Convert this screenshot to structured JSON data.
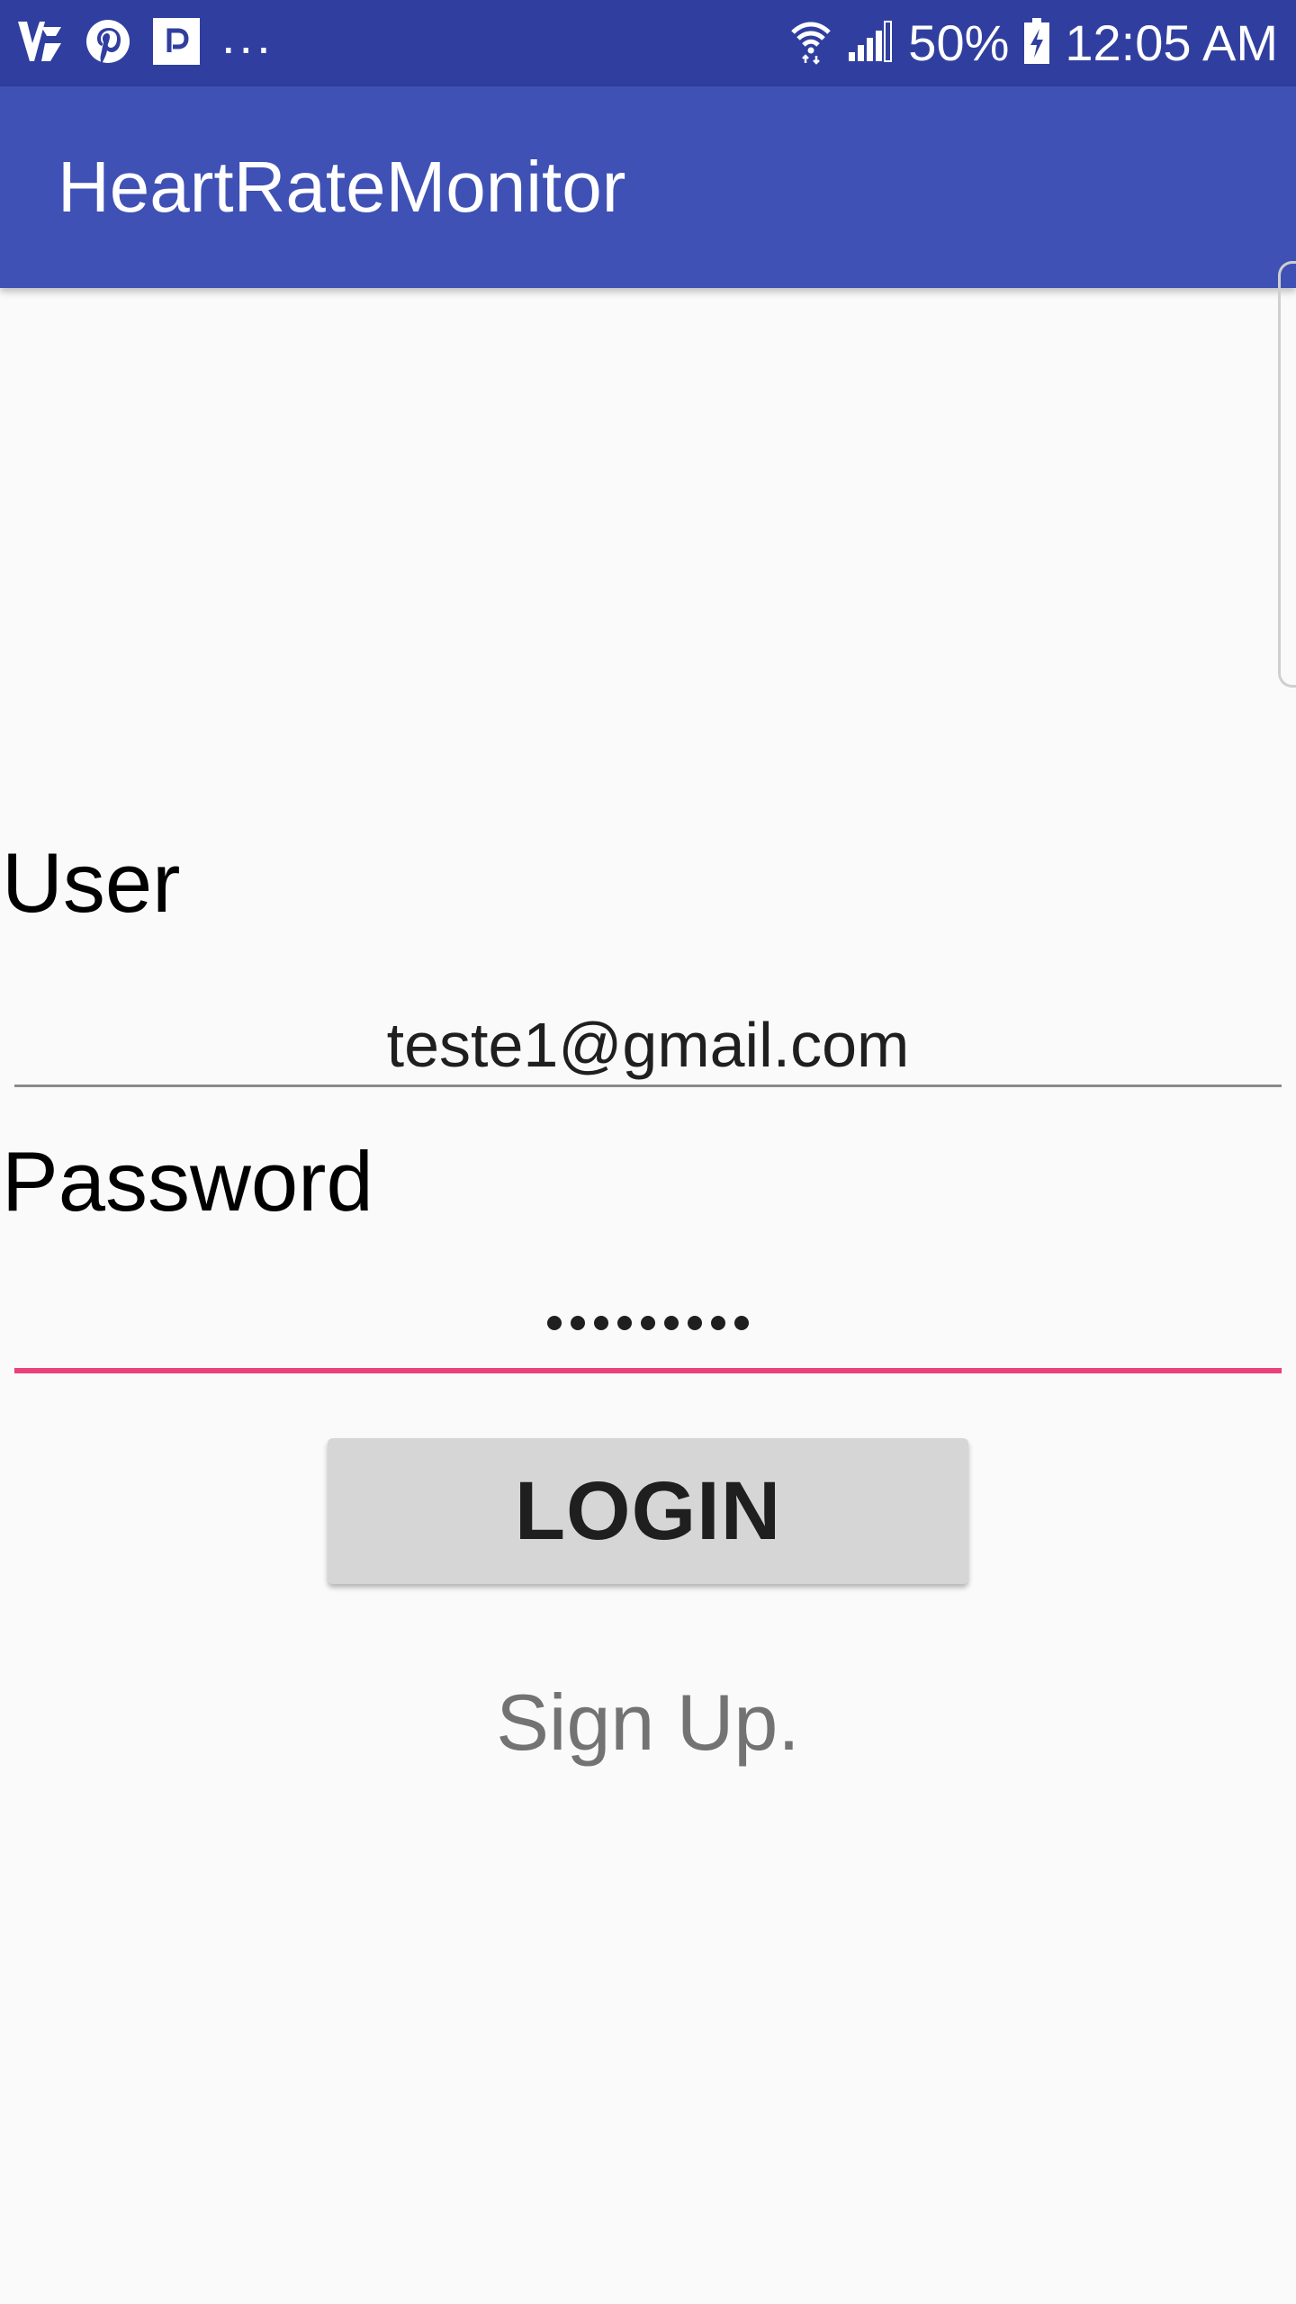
{
  "status_bar": {
    "more_indicator": "...",
    "battery": "50%",
    "time": "12:05 AM",
    "left_icons": [
      "vk-icon",
      "pinterest-icon",
      "parking-app-icon"
    ],
    "right_icons": [
      "wifi-icon",
      "signal-icon",
      "battery-charging-icon"
    ]
  },
  "app_bar": {
    "title": "HeartRateMonitor"
  },
  "form": {
    "user_label": "User",
    "user_value": "teste1@gmail.com",
    "password_label": "Password",
    "password_value": "•••••••••",
    "login_label": "LOGIN",
    "signup_label": "Sign Up."
  },
  "colors": {
    "status_bar": "#303f9f",
    "app_bar": "#3f51b5",
    "accent": "#ec407a",
    "background": "#fafafa"
  }
}
